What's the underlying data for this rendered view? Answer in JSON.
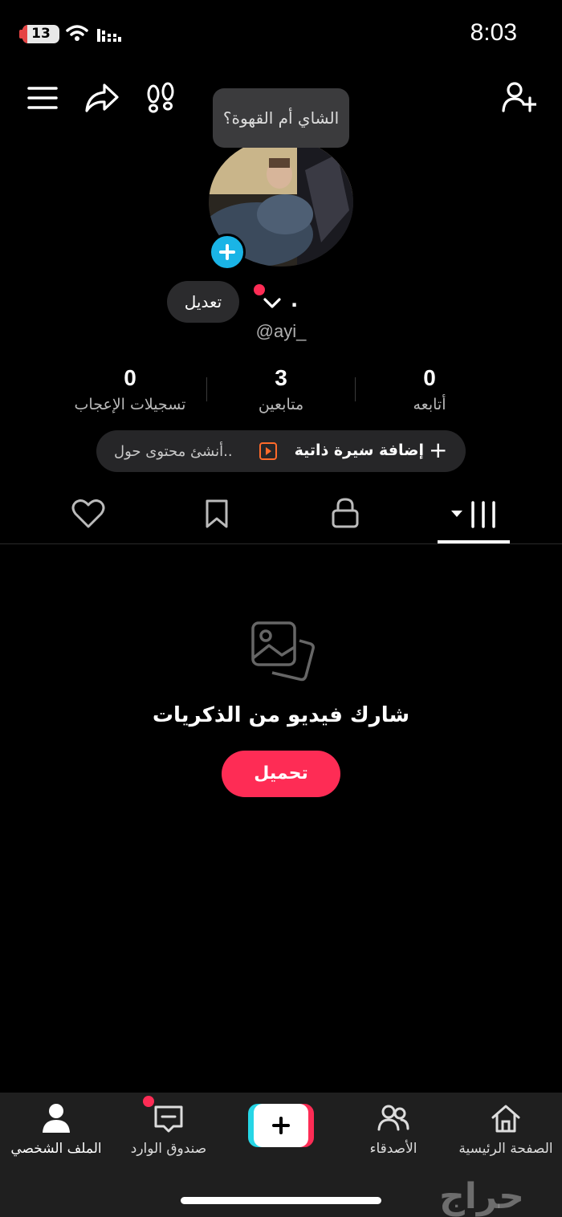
{
  "status_bar": {
    "battery_level": "13",
    "battery_fraction": 0.13,
    "time": "8:03"
  },
  "top_bar": {
    "icons": [
      "menu-icon",
      "share-icon",
      "footprints-icon",
      "add-friend-icon"
    ]
  },
  "profile": {
    "note": "الشاي أم القهوة؟",
    "display_name": ".",
    "username": "@ayi_",
    "edit_label": "تعديل"
  },
  "stats": {
    "following": {
      "value": "0",
      "label": "أتابعه"
    },
    "followers": {
      "value": "3",
      "label": "متابعين"
    },
    "likes": {
      "value": "0",
      "label": "تسجيلات الإعجاب"
    }
  },
  "bio": {
    "add_label": "إضافة سيرة ذاتية",
    "separator": "·",
    "create_label": "أنشئ محتوى حول.."
  },
  "tabs": [
    "videos-grid-icon",
    "lock-icon",
    "bookmark-icon",
    "heart-icon"
  ],
  "empty_state": {
    "title": "شارك فيديو من الذكريات",
    "upload_label": "تحميل"
  },
  "bottom_nav": {
    "home": "الصفحة الرئيسية",
    "friends": "الأصدقاء",
    "inbox": "صندوق الوارد",
    "profile": "الملف الشخصي"
  },
  "colors": {
    "accent": "#fe2c55",
    "cyan": "#26d6e6",
    "blue": "#1ab4e6",
    "background": "#000000"
  },
  "watermark": "حراج"
}
